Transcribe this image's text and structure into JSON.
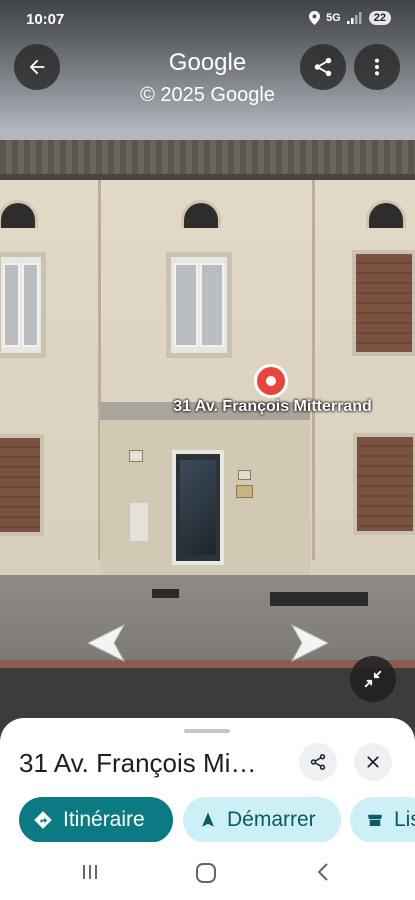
{
  "status_bar": {
    "time": "10:07",
    "network": "5G",
    "battery": "22"
  },
  "header": {
    "title": "Google",
    "copyright": "© 2025 Google",
    "back_icon": "arrow-left-icon",
    "share_icon": "share-icon",
    "menu_icon": "more-vert-icon"
  },
  "street_view": {
    "pin_label": "31 Av. François Mitterrand",
    "pin_color": "#e8453c",
    "nav_left_icon": "chevron-left-icon",
    "nav_right_icon": "chevron-right-icon",
    "exit_fullscreen_icon": "collapse-icon"
  },
  "sheet": {
    "place_name": "31 Av. François Mi…",
    "share_icon": "share-icon",
    "close_icon": "close-icon",
    "actions": [
      {
        "label": "Itinéraire",
        "icon": "directions-icon",
        "color": "#0b7a82"
      },
      {
        "label": "Démarrer",
        "icon": "navigation-icon",
        "color": "#cdf0f6"
      },
      {
        "label": "Lis",
        "icon": "store-icon",
        "color": "#cdf0f6"
      }
    ]
  },
  "system_nav": {
    "recents_icon": "recents-icon",
    "home_icon": "home-icon",
    "back_icon": "back-icon"
  }
}
